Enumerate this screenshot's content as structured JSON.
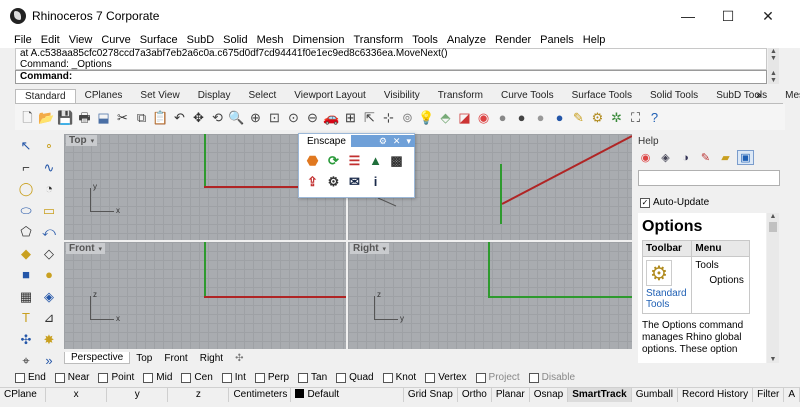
{
  "window": {
    "title": "Rhinoceros 7 Corporate",
    "minimize_glyph": "—",
    "maximize_glyph": "☐",
    "close_glyph": "✕"
  },
  "menu": [
    "File",
    "Edit",
    "View",
    "Curve",
    "Surface",
    "SubD",
    "Solid",
    "Mesh",
    "Dimension",
    "Transform",
    "Tools",
    "Analyze",
    "Render",
    "Panels",
    "Help"
  ],
  "command": {
    "history_line1": "at A.c538aa85cfc0278ccd7a3abf7eb2a6c0a.c675d0df7cd94441f0e1ec9ed8c6336ea.MoveNext()",
    "history_line2": "Command: _Options",
    "prompt": "Command:"
  },
  "toolbar_tabs": [
    "Standard",
    "CPlanes",
    "Set View",
    "Display",
    "Select",
    "Viewport Layout",
    "Visibility",
    "Transform",
    "Curve Tools",
    "Surface Tools",
    "Solid Tools",
    "SubD Tools",
    "Mesh Tools"
  ],
  "toolbar_more": "»",
  "standard_icons": [
    {
      "name": "new-file-icon",
      "glyph": "🗋",
      "color": "#555"
    },
    {
      "name": "open-folder-icon",
      "glyph": "📂",
      "color": "#d9a520"
    },
    {
      "name": "save-icon",
      "glyph": "💾",
      "color": "#335"
    },
    {
      "name": "print-icon",
      "glyph": "🖶",
      "color": "#444"
    },
    {
      "name": "import-icon",
      "glyph": "⬓",
      "color": "#4a6fa5"
    },
    {
      "name": "cut-icon",
      "glyph": "✂",
      "color": "#333"
    },
    {
      "name": "copy-icon",
      "glyph": "⧉",
      "color": "#444"
    },
    {
      "name": "paste-icon",
      "glyph": "📋",
      "color": "#c9a63a"
    },
    {
      "name": "undo-icon",
      "glyph": "↶",
      "color": "#333"
    },
    {
      "name": "pan-icon",
      "glyph": "✥",
      "color": "#333"
    },
    {
      "name": "rotate-view-icon",
      "glyph": "⟲",
      "color": "#444"
    },
    {
      "name": "zoom-icon",
      "glyph": "🔍",
      "color": "#444"
    },
    {
      "name": "zoom-window-icon",
      "glyph": "⊕",
      "color": "#444"
    },
    {
      "name": "zoom-extents-icon",
      "glyph": "⊡",
      "color": "#444"
    },
    {
      "name": "zoom-selected-icon",
      "glyph": "⊙",
      "color": "#444"
    },
    {
      "name": "zoom-out-icon",
      "glyph": "⊖",
      "color": "#444"
    },
    {
      "name": "car-icon",
      "glyph": "🚗",
      "color": "#c22"
    },
    {
      "name": "four-viewports-icon",
      "glyph": "⊞",
      "color": "#333"
    },
    {
      "name": "select-icon",
      "glyph": "⇱",
      "color": "#444"
    },
    {
      "name": "grid-icon",
      "glyph": "⊹",
      "color": "#444"
    },
    {
      "name": "osnap-icon",
      "glyph": "⊚",
      "color": "#888"
    },
    {
      "name": "light-icon",
      "glyph": "💡",
      "color": "#caa"
    },
    {
      "name": "layer-icon",
      "glyph": "⬘",
      "color": "#7a7"
    },
    {
      "name": "properties-icon",
      "glyph": "◪",
      "color": "#c33"
    },
    {
      "name": "color-wheel-icon",
      "glyph": "◉",
      "color": "#d44"
    },
    {
      "name": "render-sphere-icon",
      "glyph": "●",
      "color": "#888"
    },
    {
      "name": "shaded-sphere-icon",
      "glyph": "●",
      "color": "#444"
    },
    {
      "name": "rendered-sphere-icon",
      "glyph": "●",
      "color": "#999"
    },
    {
      "name": "blue-sphere-icon",
      "glyph": "●",
      "color": "#2456a8"
    },
    {
      "name": "pencil-icon",
      "glyph": "✎",
      "color": "#c9a020"
    },
    {
      "name": "gear-options-icon",
      "glyph": "⚙",
      "color": "#b08a1d"
    },
    {
      "name": "grasshopper-icon",
      "glyph": "✲",
      "color": "#3a8a3a"
    },
    {
      "name": "map-icon",
      "glyph": "⛶",
      "color": "#333"
    },
    {
      "name": "help-icon",
      "glyph": "?",
      "color": "#1e5fb4"
    }
  ],
  "left_icons": [
    {
      "name": "select-arrow-icon",
      "glyph": "↖"
    },
    {
      "name": "point-icon",
      "glyph": "∘"
    },
    {
      "name": "polyline-icon",
      "glyph": "⌐"
    },
    {
      "name": "curve-icon",
      "glyph": "∿"
    },
    {
      "name": "circle-icon",
      "glyph": "◯"
    },
    {
      "name": "arc-icon",
      "glyph": "◔"
    },
    {
      "name": "ellipse-icon",
      "glyph": "⬭"
    },
    {
      "name": "rectangle-icon",
      "glyph": "▭"
    },
    {
      "name": "polygon-icon",
      "glyph": "⬠"
    },
    {
      "name": "freeform-icon",
      "glyph": "⤺"
    },
    {
      "name": "surface-icon",
      "glyph": "◆"
    },
    {
      "name": "loft-icon",
      "glyph": "◇"
    },
    {
      "name": "box-icon",
      "glyph": "■"
    },
    {
      "name": "sphere-icon",
      "glyph": "●"
    },
    {
      "name": "mesh-icon",
      "glyph": "▦"
    },
    {
      "name": "subd-icon",
      "glyph": "◈"
    },
    {
      "name": "text-icon",
      "glyph": "T"
    },
    {
      "name": "dimension-icon",
      "glyph": "⊿"
    },
    {
      "name": "transform-icon",
      "glyph": "✣"
    },
    {
      "name": "explode-icon",
      "glyph": "✸"
    },
    {
      "name": "analyze-icon",
      "glyph": "⌖"
    },
    {
      "name": "more-icon",
      "glyph": "»"
    }
  ],
  "viewports": {
    "top": "Top",
    "front": "Front",
    "right": "Right",
    "perspective_dd": "▾"
  },
  "enscape": {
    "title": "Enscape",
    "gear_glyph": "⚙",
    "close_glyph": "✕",
    "menu_glyph": "▾",
    "icons": [
      {
        "name": "enscape-start-icon",
        "glyph": "⬣",
        "color": "#e07820"
      },
      {
        "name": "enscape-sync-icon",
        "glyph": "⟳",
        "color": "#2a9a3a"
      },
      {
        "name": "enscape-views-icon",
        "glyph": "☰",
        "color": "#c23030"
      },
      {
        "name": "enscape-tree-icon",
        "glyph": "▲",
        "color": "#1f6e3a"
      },
      {
        "name": "enscape-pattern-icon",
        "glyph": "▩",
        "color": "#333"
      },
      {
        "name": "enscape-upload-icon",
        "glyph": "⇪",
        "color": "#c23030"
      },
      {
        "name": "enscape-settings-icon",
        "glyph": "⚙",
        "color": "#333"
      },
      {
        "name": "enscape-mail-icon",
        "glyph": "✉",
        "color": "#1a2a4a"
      },
      {
        "name": "enscape-info-icon",
        "glyph": "i",
        "color": "#1a2a4a"
      }
    ]
  },
  "viewport_tabs": [
    "Perspective",
    "Top",
    "Front",
    "Right"
  ],
  "viewport_tab_add": "✣",
  "panel": {
    "title": "Help",
    "auto_update": "Auto-Update",
    "help_title": "Options",
    "table_headers": [
      "Toolbar",
      "Menu"
    ],
    "menu_path_1": "Tools",
    "menu_path_2": "Options",
    "toolbar_link_1": "Standard",
    "toolbar_link_2": "Tools",
    "description": "The Options command manages Rhino global options. These option",
    "icons": [
      {
        "name": "color-panel-icon",
        "glyph": "◉",
        "color": "#d44"
      },
      {
        "name": "layers-panel-icon",
        "glyph": "◈",
        "color": "#445"
      },
      {
        "name": "display-panel-icon",
        "glyph": "◑",
        "color": "#335"
      },
      {
        "name": "brush-panel-icon",
        "glyph": "✎",
        "color": "#b33"
      },
      {
        "name": "folder-panel-icon",
        "glyph": "▰",
        "color": "#c9a020"
      },
      {
        "name": "help-panel-icon",
        "glyph": "▣",
        "color": "#1e5fb4"
      }
    ]
  },
  "osnaps": [
    {
      "label": "End",
      "checked": false
    },
    {
      "label": "Near",
      "checked": false
    },
    {
      "label": "Point",
      "checked": false
    },
    {
      "label": "Mid",
      "checked": false
    },
    {
      "label": "Cen",
      "checked": false
    },
    {
      "label": "Int",
      "checked": false
    },
    {
      "label": "Perp",
      "checked": false
    },
    {
      "label": "Tan",
      "checked": false
    },
    {
      "label": "Quad",
      "checked": false
    },
    {
      "label": "Knot",
      "checked": false
    },
    {
      "label": "Vertex",
      "checked": false
    },
    {
      "label": "Project",
      "checked": false,
      "disabled": true
    },
    {
      "label": "Disable",
      "checked": false,
      "disabled": true
    }
  ],
  "status": {
    "cplane": "CPlane",
    "x": "x",
    "y": "y",
    "z": "z",
    "units": "Centimeters",
    "layer": "Default",
    "toggles": [
      "Grid Snap",
      "Ortho",
      "Planar",
      "Osnap",
      "SmartTrack",
      "Gumball",
      "Record History",
      "Filter",
      "A"
    ]
  }
}
